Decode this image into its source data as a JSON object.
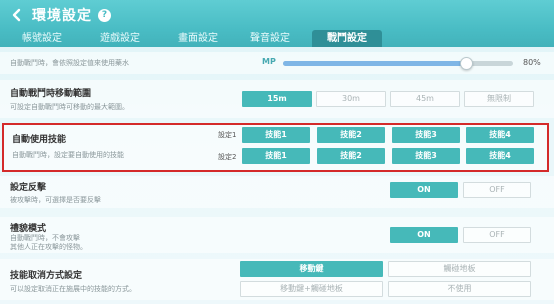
{
  "header": {
    "title": "環境設定",
    "help_glyph": "?"
  },
  "tabs": [
    {
      "label": "帳號設定",
      "active": false
    },
    {
      "label": "遊戲設定",
      "active": false
    },
    {
      "label": "畫面設定",
      "active": false
    },
    {
      "label": "聲音設定",
      "active": false
    },
    {
      "label": "戰鬥設定",
      "active": true
    }
  ],
  "mp_slider": {
    "description": "自動戰鬥時，會依照設定值來使用藥水",
    "label": "MP",
    "value_text": "80%",
    "fraction": 0.8
  },
  "range": {
    "title": "自動戰鬥時移動範圍",
    "description": "可設定自動戰鬥時可移動的最大範圍。",
    "options": [
      "15m",
      "30m",
      "45m",
      "無限制"
    ],
    "selected": "15m"
  },
  "skills": {
    "title": "自動使用技能",
    "description": "自動戰鬥時，設定要自動使用的技能",
    "set1_label": "設定1",
    "set2_label": "設定2",
    "set1": [
      "技能1",
      "技能2",
      "技能3",
      "技能4"
    ],
    "set2": [
      "技能1",
      "技能2",
      "技能3",
      "技能4"
    ]
  },
  "counter": {
    "title": "設定反擊",
    "description": "被攻擊時，可選擇是否要反擊",
    "on_label": "ON",
    "off_label": "OFF",
    "state": "ON"
  },
  "courtesy": {
    "title": "禮貌模式",
    "description_line1": "自動戰鬥時，不會攻擊",
    "description_line2": "其他人正在攻擊的怪物。",
    "on_label": "ON",
    "off_label": "OFF",
    "state": "ON"
  },
  "cancel_method": {
    "title": "技能取消方式設定",
    "description": "可以設定取消正在施展中的技能的方式。",
    "options": [
      "移動鍵",
      "觸碰地板",
      "移動鍵+觸碰地板",
      "不使用"
    ],
    "selected": "移動鍵"
  },
  "colors": {
    "accent": "#46b9b9",
    "header": "#49bcc4",
    "highlight_border": "#d42a2a"
  },
  "icons": {
    "back": "back-arrow-icon",
    "help": "help-icon"
  }
}
